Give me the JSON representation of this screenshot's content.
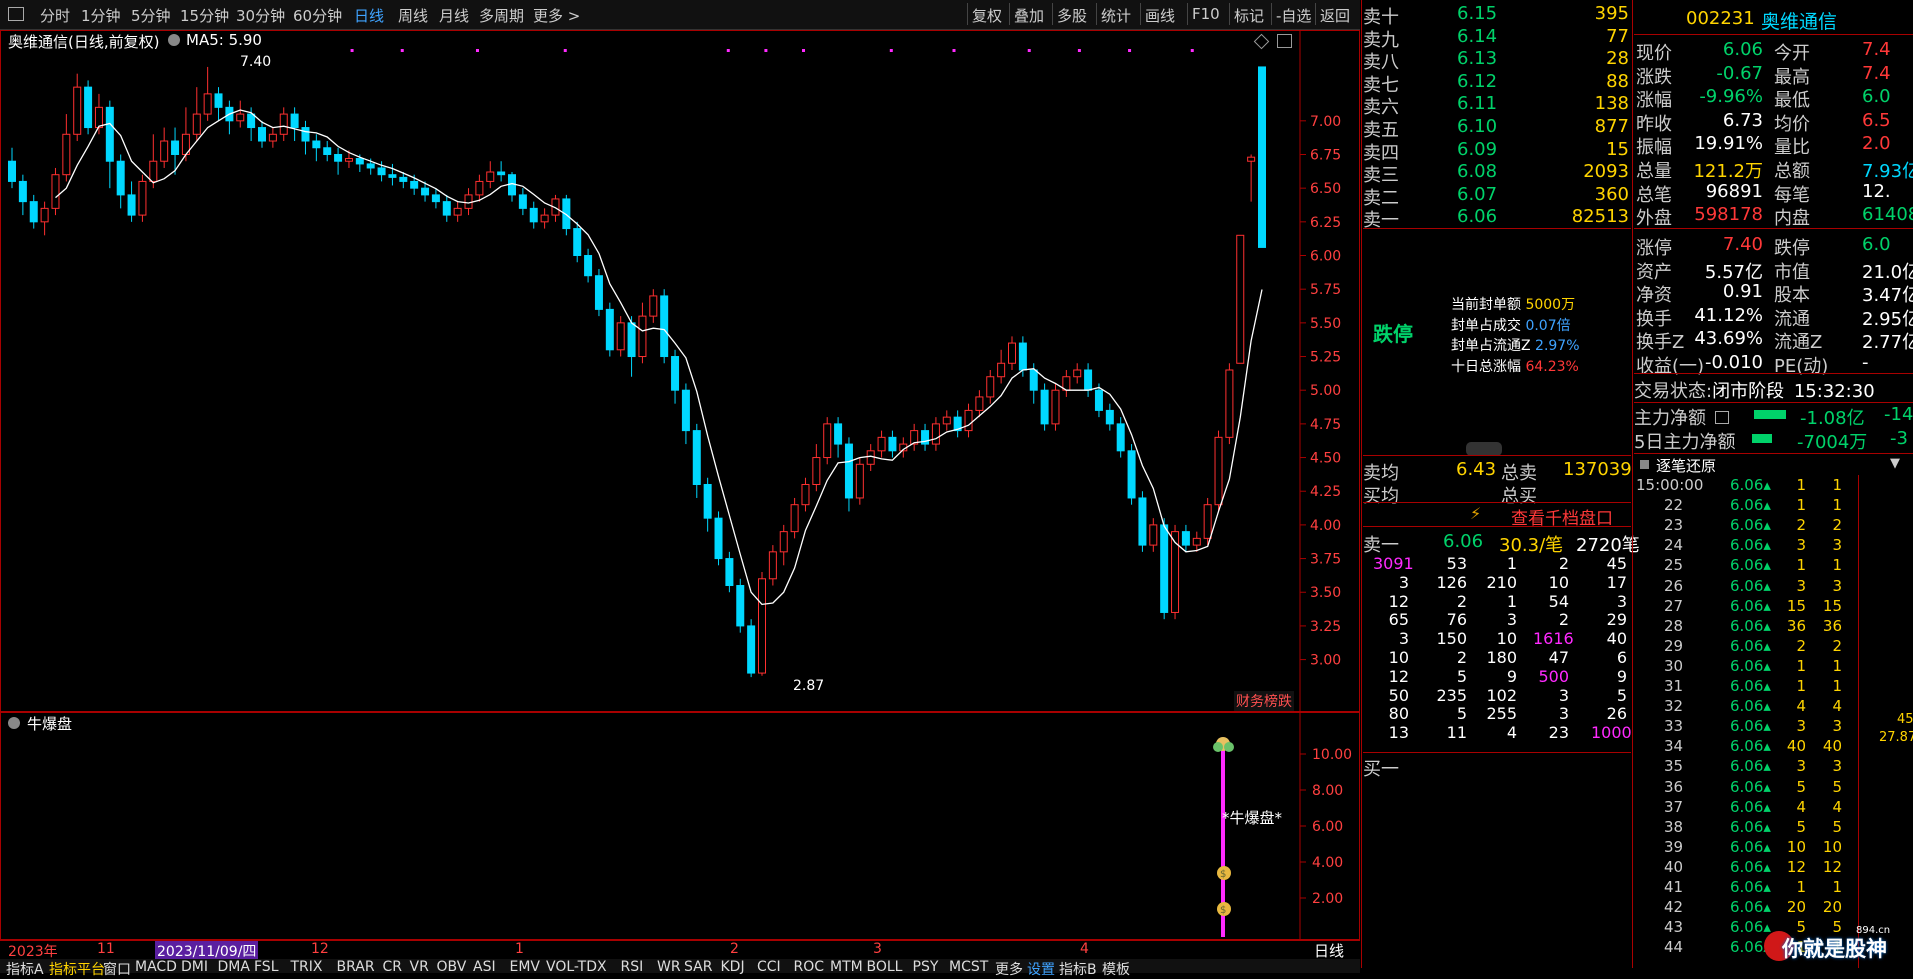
{
  "toolbar": {
    "periods": [
      "分时",
      "1分钟",
      "5分钟",
      "15分钟",
      "30分钟",
      "60分钟",
      "日线",
      "周线",
      "月线",
      "多周期",
      "更多 >"
    ],
    "active_period": "日线",
    "right_buttons": [
      "复权",
      "叠加",
      "多股",
      "统计",
      "画线",
      "F10",
      "标记",
      "-自选",
      "返回"
    ]
  },
  "main_chart": {
    "title": "奥维通信(日线,前复权)",
    "ma_label": "MA5: 5.90",
    "high_label": "7.40",
    "low_label": "2.87",
    "badge": "财务榜跌",
    "y_ticks": [
      "7.00",
      "6.75",
      "6.50",
      "6.25",
      "6.00",
      "5.75",
      "5.50",
      "5.25",
      "5.00",
      "4.75",
      "4.50",
      "4.25",
      "4.00",
      "3.75",
      "3.50",
      "3.25",
      "3.00"
    ]
  },
  "chart_data": {
    "type": "candlestick",
    "ylim": [
      2.7,
      7.6
    ],
    "candles": [
      [
        6.7,
        6.55,
        6.8,
        6.5
      ],
      [
        6.55,
        6.4,
        6.6,
        6.3
      ],
      [
        6.4,
        6.25,
        6.45,
        6.2
      ],
      [
        6.25,
        6.35,
        6.4,
        6.15
      ],
      [
        6.35,
        6.6,
        6.65,
        6.3
      ],
      [
        6.6,
        6.9,
        7.05,
        6.55
      ],
      [
        6.9,
        7.25,
        7.35,
        6.85
      ],
      [
        7.25,
        6.95,
        7.3,
        6.9
      ],
      [
        6.95,
        7.1,
        7.2,
        6.9
      ],
      [
        7.1,
        6.7,
        7.15,
        6.5
      ],
      [
        6.7,
        6.45,
        6.75,
        6.35
      ],
      [
        6.45,
        6.3,
        6.55,
        6.25
      ],
      [
        6.3,
        6.55,
        6.6,
        6.25
      ],
      [
        6.55,
        6.7,
        6.9,
        6.5
      ],
      [
        6.7,
        6.85,
        6.95,
        6.65
      ],
      [
        6.85,
        6.75,
        6.95,
        6.6
      ],
      [
        6.75,
        6.9,
        7.1,
        6.7
      ],
      [
        6.9,
        7.05,
        7.25,
        6.85
      ],
      [
        7.05,
        7.2,
        7.4,
        7.0
      ],
      [
        7.2,
        7.1,
        7.25,
        7.0
      ],
      [
        7.1,
        7.0,
        7.15,
        6.9
      ],
      [
        7.0,
        7.05,
        7.15,
        6.95
      ],
      [
        7.05,
        6.95,
        7.1,
        6.85
      ],
      [
        6.95,
        6.85,
        7.0,
        6.8
      ],
      [
        6.85,
        6.9,
        6.95,
        6.8
      ],
      [
        6.9,
        7.05,
        7.1,
        6.85
      ],
      [
        7.05,
        6.95,
        7.1,
        6.85
      ],
      [
        6.95,
        6.85,
        7.0,
        6.75
      ],
      [
        6.85,
        6.8,
        6.9,
        6.7
      ],
      [
        6.8,
        6.75,
        6.85,
        6.7
      ],
      [
        6.75,
        6.7,
        6.8,
        6.6
      ],
      [
        6.7,
        6.72,
        6.78,
        6.65
      ],
      [
        6.72,
        6.68,
        6.75,
        6.62
      ],
      [
        6.68,
        6.65,
        6.72,
        6.6
      ],
      [
        6.65,
        6.6,
        6.7,
        6.55
      ],
      [
        6.6,
        6.58,
        6.68,
        6.52
      ],
      [
        6.58,
        6.55,
        6.62,
        6.5
      ],
      [
        6.55,
        6.5,
        6.6,
        6.45
      ],
      [
        6.5,
        6.45,
        6.55,
        6.4
      ],
      [
        6.45,
        6.4,
        6.5,
        6.35
      ],
      [
        6.4,
        6.3,
        6.45,
        6.25
      ],
      [
        6.3,
        6.35,
        6.4,
        6.25
      ],
      [
        6.35,
        6.45,
        6.5,
        6.3
      ],
      [
        6.45,
        6.55,
        6.6,
        6.4
      ],
      [
        6.55,
        6.62,
        6.7,
        6.5
      ],
      [
        6.62,
        6.6,
        6.7,
        6.55
      ],
      [
        6.6,
        6.45,
        6.62,
        6.4
      ],
      [
        6.45,
        6.35,
        6.5,
        6.3
      ],
      [
        6.35,
        6.25,
        6.4,
        6.2
      ],
      [
        6.25,
        6.3,
        6.35,
        6.2
      ],
      [
        6.3,
        6.42,
        6.45,
        6.25
      ],
      [
        6.42,
        6.2,
        6.45,
        6.15
      ],
      [
        6.2,
        6.0,
        6.25,
        5.95
      ],
      [
        6.0,
        5.85,
        6.05,
        5.8
      ],
      [
        5.85,
        5.6,
        5.9,
        5.55
      ],
      [
        5.6,
        5.3,
        5.65,
        5.25
      ],
      [
        5.3,
        5.5,
        5.55,
        5.25
      ],
      [
        5.5,
        5.25,
        5.55,
        5.1
      ],
      [
        5.25,
        5.55,
        5.65,
        5.2
      ],
      [
        5.55,
        5.7,
        5.75,
        5.5
      ],
      [
        5.7,
        5.25,
        5.75,
        5.2
      ],
      [
        5.25,
        5.0,
        5.3,
        4.9
      ],
      [
        5.0,
        4.7,
        5.05,
        4.6
      ],
      [
        4.7,
        4.3,
        4.75,
        4.2
      ],
      [
        4.3,
        4.05,
        4.35,
        3.95
      ],
      [
        4.05,
        3.75,
        4.1,
        3.7
      ],
      [
        3.75,
        3.55,
        3.8,
        3.5
      ],
      [
        3.55,
        3.25,
        3.6,
        3.2
      ],
      [
        3.25,
        2.9,
        3.3,
        2.87
      ],
      [
        2.9,
        3.6,
        3.65,
        2.88
      ],
      [
        3.6,
        3.8,
        3.85,
        3.55
      ],
      [
        3.8,
        3.95,
        4.0,
        3.7
      ],
      [
        3.95,
        4.15,
        4.2,
        3.9
      ],
      [
        4.15,
        4.3,
        4.35,
        4.1
      ],
      [
        4.3,
        4.5,
        4.6,
        4.25
      ],
      [
        4.5,
        4.75,
        4.8,
        4.45
      ],
      [
        4.75,
        4.6,
        4.8,
        4.5
      ],
      [
        4.6,
        4.2,
        4.65,
        4.1
      ],
      [
        4.2,
        4.45,
        4.5,
        4.15
      ],
      [
        4.45,
        4.55,
        4.6,
        4.4
      ],
      [
        4.55,
        4.65,
        4.7,
        4.5
      ],
      [
        4.65,
        4.55,
        4.7,
        4.5
      ],
      [
        4.55,
        4.6,
        4.65,
        4.5
      ],
      [
        4.6,
        4.7,
        4.75,
        4.55
      ],
      [
        4.7,
        4.6,
        4.75,
        4.55
      ],
      [
        4.6,
        4.75,
        4.8,
        4.55
      ],
      [
        4.75,
        4.8,
        4.85,
        4.7
      ],
      [
        4.8,
        4.7,
        4.85,
        4.65
      ],
      [
        4.7,
        4.85,
        4.9,
        4.65
      ],
      [
        4.85,
        4.95,
        5.0,
        4.8
      ],
      [
        4.95,
        5.1,
        5.15,
        4.9
      ],
      [
        5.1,
        5.2,
        5.3,
        5.05
      ],
      [
        5.2,
        5.35,
        5.4,
        5.15
      ],
      [
        5.35,
        5.15,
        5.4,
        5.1
      ],
      [
        5.15,
        5.0,
        5.2,
        4.9
      ],
      [
        5.0,
        4.75,
        5.05,
        4.7
      ],
      [
        4.75,
        5.0,
        5.05,
        4.7
      ],
      [
        5.0,
        5.1,
        5.15,
        4.95
      ],
      [
        5.1,
        5.15,
        5.2,
        5.05
      ],
      [
        5.15,
        5.0,
        5.2,
        4.95
      ],
      [
        5.0,
        4.85,
        5.05,
        4.8
      ],
      [
        4.85,
        4.75,
        4.9,
        4.7
      ],
      [
        4.75,
        4.55,
        4.8,
        4.5
      ],
      [
        4.55,
        4.2,
        4.6,
        4.15
      ],
      [
        4.2,
        3.85,
        4.25,
        3.8
      ],
      [
        3.85,
        4.0,
        4.05,
        3.8
      ],
      [
        4.0,
        3.35,
        4.05,
        3.3
      ],
      [
        3.35,
        3.95,
        4.0,
        3.3
      ],
      [
        3.95,
        3.85,
        4.0,
        3.8
      ],
      [
        3.85,
        3.9,
        3.95,
        3.8
      ],
      [
        3.9,
        4.15,
        4.2,
        3.85
      ],
      [
        4.15,
        4.65,
        4.7,
        4.1
      ],
      [
        4.65,
        5.15,
        5.2,
        4.6
      ],
      [
        5.2,
        6.15,
        6.15,
        5.2
      ],
      [
        6.7,
        6.73,
        6.75,
        6.4
      ],
      [
        7.4,
        6.06,
        7.4,
        6.06
      ]
    ],
    "ma5_label": "MA5"
  },
  "indicator": {
    "title": "牛爆盘",
    "label": "*牛爆盘*",
    "y_ticks": [
      "10.00",
      "8.00",
      "6.00",
      "4.00",
      "2.00"
    ],
    "period_label": "日线",
    "dates": [
      "2023年",
      "11",
      "2023/11/09/四",
      "12",
      "1",
      "2",
      "3",
      "4"
    ]
  },
  "bottom_tabs": [
    "指标A",
    "指标平台",
    "窗口",
    "MACD",
    "DMI",
    "DMA",
    "FSL",
    "TRIX",
    "BRAR",
    "CR",
    "VR",
    "OBV",
    "ASI",
    "EMV",
    "VOL-TDX",
    "RSI",
    "WR",
    "SAR",
    "KDJ",
    "CCI",
    "ROC",
    "MTM",
    "BOLL",
    "PSY",
    "MCST",
    "更多",
    "设置",
    "指标B",
    "模板"
  ],
  "order_book": {
    "asks": [
      {
        "label": "卖十",
        "price": "6.15",
        "vol": "395"
      },
      {
        "label": "卖九",
        "price": "6.14",
        "vol": "77"
      },
      {
        "label": "卖八",
        "price": "6.13",
        "vol": "28"
      },
      {
        "label": "卖七",
        "price": "6.12",
        "vol": "88"
      },
      {
        "label": "卖六",
        "price": "6.11",
        "vol": "138"
      },
      {
        "label": "卖五",
        "price": "6.10",
        "vol": "877"
      },
      {
        "label": "卖四",
        "price": "6.09",
        "vol": "15"
      },
      {
        "label": "卖三",
        "price": "6.08",
        "vol": "2093"
      },
      {
        "label": "卖二",
        "price": "6.07",
        "vol": "360"
      },
      {
        "label": "卖一",
        "price": "6.06",
        "vol": "82513"
      }
    ],
    "limit_down": "跌停",
    "seal_stats": [
      {
        "label": "当前封单额",
        "value": "5000万"
      },
      {
        "label": "封单占成交",
        "value": "0.07倍"
      },
      {
        "label": "封单占流通Z",
        "value": "2.97%"
      },
      {
        "label": "十日总涨幅",
        "value": "64.23%"
      }
    ],
    "sell_avg_label": "卖均",
    "sell_avg": "6.43",
    "total_sell_label": "总卖",
    "total_sell": "137039",
    "buy_avg_label": "买均",
    "total_buy_label": "总买",
    "depth_button": "查看千档盘口",
    "queue_head": {
      "label": "卖一",
      "price": "6.06",
      "avg": "30.3/笔",
      "count": "2720笔"
    },
    "queue": [
      [
        "3091",
        "53",
        "1",
        "2",
        "45"
      ],
      [
        "3",
        "126",
        "210",
        "10",
        "17"
      ],
      [
        "12",
        "2",
        "1",
        "54",
        "3"
      ],
      [
        "65",
        "76",
        "3",
        "2",
        "29"
      ],
      [
        "3",
        "150",
        "10",
        "1616",
        "40"
      ],
      [
        "10",
        "2",
        "180",
        "47",
        "6"
      ],
      [
        "12",
        "5",
        "9",
        "500",
        "9"
      ],
      [
        "50",
        "235",
        "102",
        "3",
        "5"
      ],
      [
        "80",
        "5",
        "255",
        "3",
        "26"
      ],
      [
        "13",
        "11",
        "4",
        "23",
        "1000"
      ]
    ],
    "buy1_label": "买一"
  },
  "quote": {
    "code": "002231",
    "name": "奥维通信",
    "rows": [
      {
        "l1": "现价",
        "v1": "6.06",
        "l2": "今开",
        "v2": "7.4"
      },
      {
        "l1": "涨跌",
        "v1": "-0.67",
        "l2": "最高",
        "v2": "7.4"
      },
      {
        "l1": "涨幅",
        "v1": "-9.96%",
        "l2": "最低",
        "v2": "6.0"
      },
      {
        "l1": "昨收",
        "v1": "6.73",
        "l2": "均价",
        "v2": "6.5"
      },
      {
        "l1": "振幅",
        "v1": "19.91%",
        "l2": "量比",
        "v2": "2.0"
      },
      {
        "l1": "总量",
        "v1": "121.2万",
        "l2": "总额",
        "v2": "7.93亿"
      },
      {
        "l1": "总笔",
        "v1": "96891",
        "l2": "每笔",
        "v2": "12."
      },
      {
        "l1": "外盘",
        "v1": "598178",
        "l2": "内盘",
        "v2": "61408"
      }
    ],
    "rows2": [
      {
        "l1": "涨停",
        "v1": "7.40",
        "l2": "跌停",
        "v2": "6.0"
      },
      {
        "l1": "资产",
        "v1": "5.57亿",
        "l2": "市值",
        "v2": "21.0亿"
      },
      {
        "l1": "净资",
        "v1": "0.91",
        "l2": "股本",
        "v2": "3.47亿"
      },
      {
        "l1": "换手",
        "v1": "41.12%",
        "l2": "流通",
        "v2": "2.95亿"
      },
      {
        "l1": "换手Z",
        "v1": "43.69%",
        "l2": "流通Z",
        "v2": "2.77亿"
      },
      {
        "l1": "收益(一)",
        "v1": "-0.010",
        "l2": "PE(动)",
        "v2": "-"
      }
    ],
    "trade_state_label": "交易状态:",
    "trade_state": "闭市阶段",
    "trade_time": "15:32:30",
    "main_flow_label": "主力净额",
    "main_flow": "-1.08亿",
    "main_flow2": "-14",
    "main5_label": "5日主力净额",
    "main5": "-7004万",
    "main5_2": "-3",
    "ticks_title": "逐笔还原",
    "ticks": [
      [
        "15:00:00",
        "6.06",
        "1",
        "1"
      ],
      [
        "22",
        "6.06",
        "1",
        "1"
      ],
      [
        "23",
        "6.06",
        "2",
        "2"
      ],
      [
        "24",
        "6.06",
        "3",
        "3"
      ],
      [
        "25",
        "6.06",
        "1",
        "1"
      ],
      [
        "26",
        "6.06",
        "3",
        "3"
      ],
      [
        "27",
        "6.06",
        "15",
        "15"
      ],
      [
        "28",
        "6.06",
        "36",
        "36"
      ],
      [
        "29",
        "6.06",
        "2",
        "2"
      ],
      [
        "30",
        "6.06",
        "1",
        "1"
      ],
      [
        "31",
        "6.06",
        "1",
        "1"
      ],
      [
        "32",
        "6.06",
        "4",
        "4"
      ],
      [
        "33",
        "6.06",
        "3",
        "3"
      ],
      [
        "34",
        "6.06",
        "40",
        "40"
      ],
      [
        "35",
        "6.06",
        "3",
        "3"
      ],
      [
        "36",
        "6.06",
        "5",
        "5"
      ],
      [
        "37",
        "6.06",
        "4",
        "4"
      ],
      [
        "38",
        "6.06",
        "5",
        "5"
      ],
      [
        "39",
        "6.06",
        "10",
        "10"
      ],
      [
        "40",
        "6.06",
        "12",
        "12"
      ],
      [
        "41",
        "6.06",
        "1",
        "1"
      ],
      [
        "42",
        "6.06",
        "20",
        "20"
      ],
      [
        "43",
        "6.06",
        "5",
        "5"
      ],
      [
        "44",
        "6.06",
        "1",
        "1"
      ]
    ],
    "side_numbers": [
      "45",
      "27.87"
    ],
    "watermark": "你就是股神",
    "watermark_url": "894.cn"
  }
}
